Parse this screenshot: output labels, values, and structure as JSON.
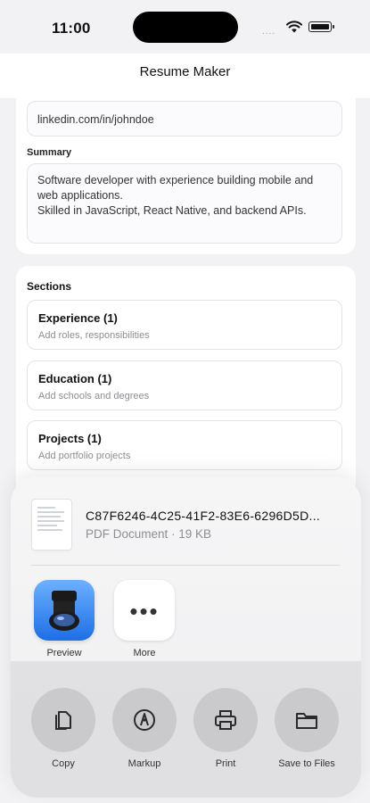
{
  "status_bar": {
    "time": "11:00",
    "signal": "....",
    "icons": [
      "wifi-icon",
      "battery-icon"
    ]
  },
  "nav": {
    "title": "Resume Maker"
  },
  "form": {
    "linkedin_value": "linkedin.com/in/johndoe",
    "summary_label": "Summary",
    "summary_value": "Software developer with experience building mobile and web applications.\nSkilled in JavaScript, React Native, and backend APIs."
  },
  "sections": {
    "title": "Sections",
    "items": [
      {
        "title": "Experience (1)",
        "subtitle": "Add roles, responsibilities"
      },
      {
        "title": "Education (1)",
        "subtitle": "Add schools and degrees"
      },
      {
        "title": "Projects (1)",
        "subtitle": "Add portfolio projects"
      }
    ]
  },
  "share_sheet": {
    "file_name": "C87F6246-4C25-41F2-83E6-6296D5D...",
    "file_meta": "PDF Document · 19 KB",
    "apps": [
      {
        "label": "Preview",
        "icon": "preview-app-icon"
      },
      {
        "label": "More",
        "icon": "more-icon"
      }
    ],
    "actions": [
      {
        "label": "Copy",
        "icon": "copy-icon"
      },
      {
        "label": "Markup",
        "icon": "markup-icon"
      },
      {
        "label": "Print",
        "icon": "print-icon"
      },
      {
        "label": "Save to Files",
        "icon": "folder-icon"
      }
    ]
  },
  "colors": {
    "accent": "#1d6fe6",
    "background": "#f2f2f4",
    "muted_text": "#8e8e93"
  }
}
